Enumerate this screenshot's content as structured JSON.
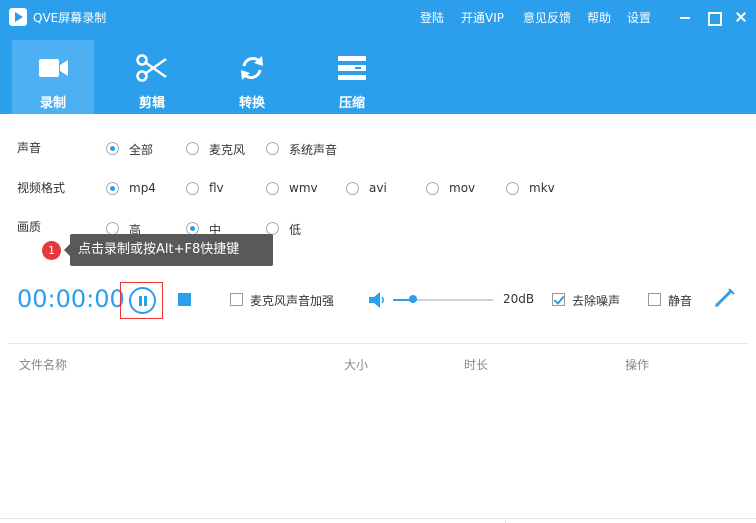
{
  "titlebar": {
    "app_title": "QVE屏幕录制",
    "menu": {
      "login": "登陆",
      "vip": "开通VIP",
      "feedback": "意见反馈",
      "help": "帮助",
      "settings": "设置"
    }
  },
  "tabs": [
    {
      "label": "录制",
      "icon": "video-camera-icon",
      "active": true
    },
    {
      "label": "剪辑",
      "icon": "scissors-icon",
      "active": false
    },
    {
      "label": "转换",
      "icon": "convert-arrows-icon",
      "active": false
    },
    {
      "label": "压缩",
      "icon": "compress-icon",
      "active": false
    }
  ],
  "options": {
    "sound": {
      "label": "声音",
      "choices": [
        "全部",
        "麦克风",
        "系统声音"
      ],
      "selected": "全部"
    },
    "format": {
      "label": "视频格式",
      "choices": [
        "mp4",
        "flv",
        "wmv",
        "avi",
        "mov",
        "mkv"
      ],
      "selected": "mp4"
    },
    "quality": {
      "label": "画质",
      "choices": [
        "高",
        "中",
        "低"
      ],
      "selected": "中"
    }
  },
  "tooltip": {
    "badge": "1",
    "text": "点击录制或按Alt+F8快捷键"
  },
  "controls": {
    "timer": "00:00:00",
    "mic_boost": {
      "label": "麦克风声音加强",
      "checked": false
    },
    "volume": {
      "value_label": "20dB",
      "level": 0.2
    },
    "denoise": {
      "label": "去除噪声",
      "checked": true
    },
    "mute": {
      "label": "静音",
      "checked": false
    }
  },
  "file_table": {
    "columns": [
      "文件名称",
      "大小",
      "时长",
      "操作"
    ]
  },
  "colors": {
    "accent": "#2b9eec",
    "active_tab": "#4cb0f2",
    "badge": "#e8393a",
    "tooltip_bg": "#595959"
  }
}
